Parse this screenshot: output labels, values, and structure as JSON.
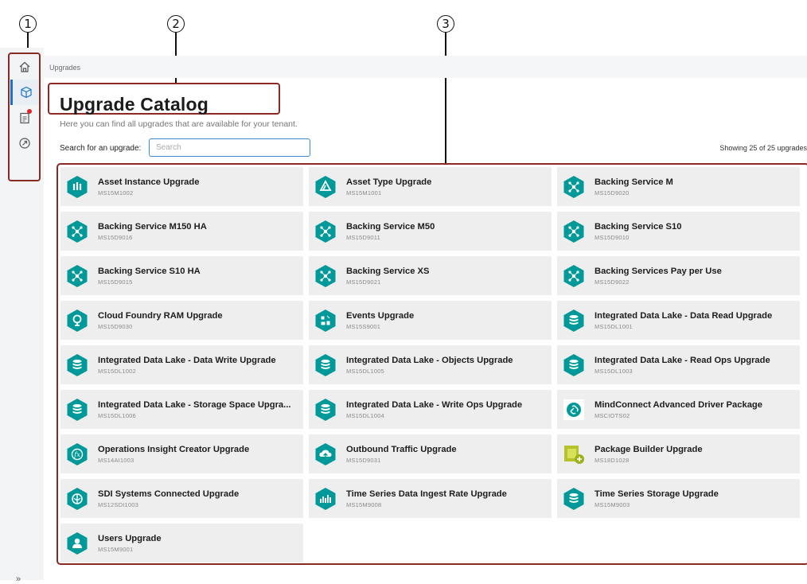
{
  "callouts": [
    "1",
    "2",
    "3"
  ],
  "breadcrumb": "Upgrades",
  "page_title": "Upgrade Catalog",
  "subtitle": "Here you can find all upgrades that are available for your tenant.",
  "search": {
    "label": "Search for an upgrade:",
    "placeholder": "Search",
    "value": ""
  },
  "showing": "Showing 25 of 25 upgrades",
  "sidebar": {
    "items": [
      {
        "icon": "home-icon"
      },
      {
        "icon": "cube-icon",
        "active": true
      },
      {
        "icon": "clipboard-icon",
        "badge": true
      },
      {
        "icon": "compass-icon"
      }
    ],
    "collapse_label": "»"
  },
  "colors": {
    "accent": "#1a73c8",
    "teal": "#009999",
    "highlight_border": "#8b2a25",
    "badge": "#e0242c"
  },
  "upgrades": [
    {
      "name": "Asset Instance Upgrade",
      "code": "MS15M1002",
      "icon": "asset-instance-icon"
    },
    {
      "name": "Asset Type Upgrade",
      "code": "MS15M1001",
      "icon": "asset-type-icon"
    },
    {
      "name": "Backing Service M",
      "code": "MS15D9020",
      "icon": "network-icon"
    },
    {
      "name": "Backing Service M150 HA",
      "code": "MS15D9016",
      "icon": "network-icon"
    },
    {
      "name": "Backing Service M50",
      "code": "MS15D9011",
      "icon": "network-icon"
    },
    {
      "name": "Backing Service S10",
      "code": "MS15D9010",
      "icon": "network-icon"
    },
    {
      "name": "Backing Service S10 HA",
      "code": "MS15D9015",
      "icon": "network-icon"
    },
    {
      "name": "Backing Service XS",
      "code": "MS15D9021",
      "icon": "network-icon"
    },
    {
      "name": "Backing Services Pay per Use",
      "code": "MS15D9022",
      "icon": "network-icon"
    },
    {
      "name": "Cloud Foundry RAM Upgrade",
      "code": "MS15D9030",
      "icon": "cloud-foundry-icon"
    },
    {
      "name": "Events Upgrade",
      "code": "MS15S9001",
      "icon": "events-icon"
    },
    {
      "name": "Integrated Data Lake - Data Read Upgrade",
      "code": "MS15DL1001",
      "icon": "database-icon"
    },
    {
      "name": "Integrated Data Lake - Data Write Upgrade",
      "code": "MS15DL1002",
      "icon": "database-icon"
    },
    {
      "name": "Integrated Data Lake - Objects Upgrade",
      "code": "MS15DL1005",
      "icon": "database-icon"
    },
    {
      "name": "Integrated Data Lake - Read Ops Upgrade",
      "code": "MS15DL1003",
      "icon": "database-icon"
    },
    {
      "name": "Integrated Data Lake - Storage Space Upgra...",
      "code": "MS15DL1006",
      "icon": "database-icon"
    },
    {
      "name": "Integrated Data Lake - Write Ops Upgrade",
      "code": "MS15DL1004",
      "icon": "database-icon"
    },
    {
      "name": "MindConnect Advanced Driver Package",
      "code": "MSCIOTS02",
      "icon": "mindconnect-icon"
    },
    {
      "name": "Operations Insight Creator Upgrade",
      "code": "MS14AI1003",
      "icon": "function-icon"
    },
    {
      "name": "Outbound Traffic Upgrade",
      "code": "MS15D9031",
      "icon": "cloud-upload-icon"
    },
    {
      "name": "Package Builder Upgrade",
      "code": "MS18D1028",
      "icon": "package-builder-icon"
    },
    {
      "name": "SDI Systems Connected Upgrade",
      "code": "MS12SDI1003",
      "icon": "sdi-icon"
    },
    {
      "name": "Time Series Data Ingest Rate Upgrade",
      "code": "MS15M9008",
      "icon": "timeseries-ingest-icon"
    },
    {
      "name": "Time Series Storage Upgrade",
      "code": "MS15M9003",
      "icon": "database-icon"
    },
    {
      "name": "Users Upgrade",
      "code": "MS15M9001",
      "icon": "user-icon"
    }
  ]
}
